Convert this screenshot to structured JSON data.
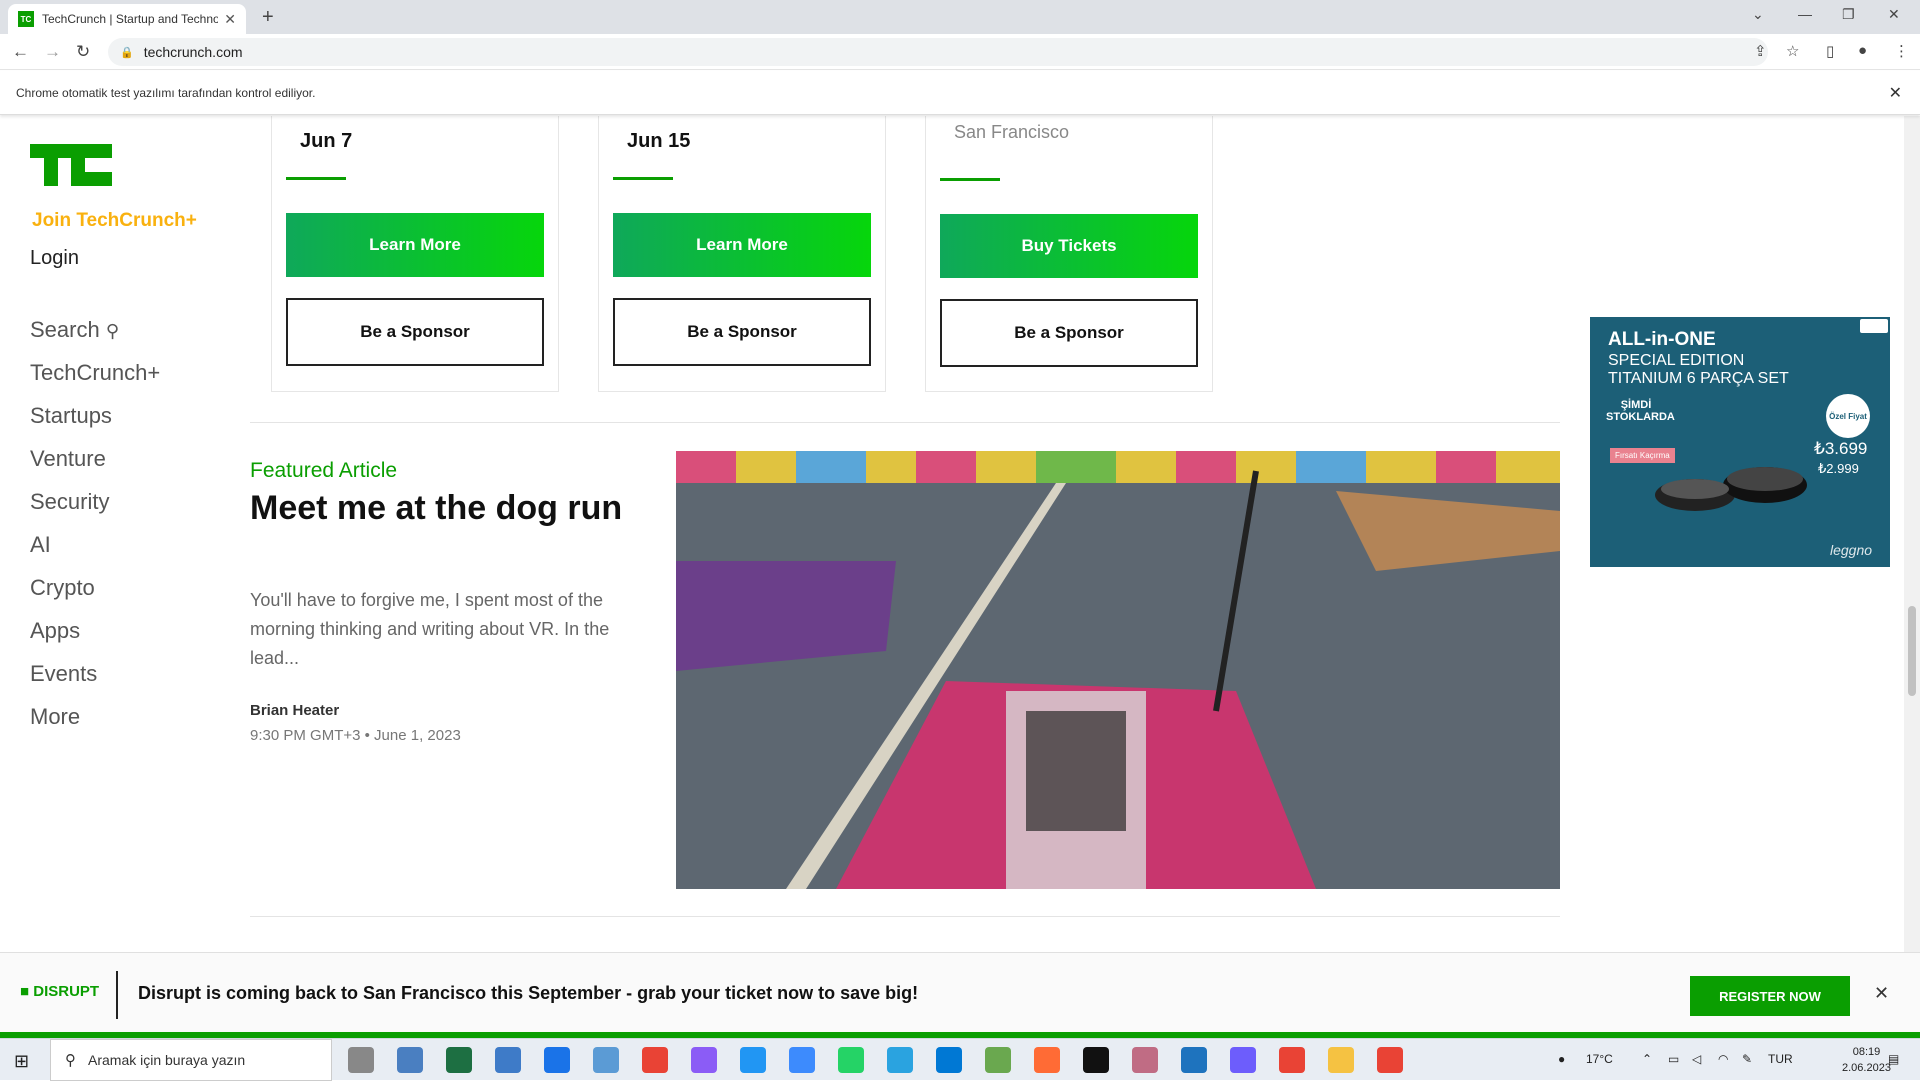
{
  "browser": {
    "tab_title": "TechCrunch | Startup and Technology News",
    "url": "techcrunch.com",
    "automation_notice": "Chrome otomatik test yazılımı tarafından kontrol ediliyor."
  },
  "sidebar": {
    "join": "Join TechCrunch+",
    "login": "Login",
    "items": [
      {
        "label": "Search"
      },
      {
        "label": "TechCrunch+"
      },
      {
        "label": "Startups"
      },
      {
        "label": "Venture"
      },
      {
        "label": "Security"
      },
      {
        "label": "AI"
      },
      {
        "label": "Crypto"
      },
      {
        "label": "Apps"
      },
      {
        "label": "Events"
      },
      {
        "label": "More"
      }
    ]
  },
  "events": [
    {
      "date": "Jun 7",
      "primary": "Learn More",
      "secondary": "Be a Sponsor"
    },
    {
      "date": "Jun 15",
      "primary": "Learn More",
      "secondary": "Be a Sponsor"
    },
    {
      "location": "San Francisco",
      "primary": "Buy Tickets",
      "secondary": "Be a Sponsor"
    }
  ],
  "featured": {
    "label": "Featured Article",
    "title": "Meet me at the dog run",
    "excerpt": "You'll have to forgive me, I spent most of the morning thinking and writing about VR. In the lead...",
    "author": "Brian Heater",
    "date": "9:30 PM GMT+3 • June 1, 2023"
  },
  "ad": {
    "line1": "ALL-in-ONE",
    "line2": "SPECIAL EDITION",
    "line3": "TITANIUM 6 PARÇA SET",
    "stock": "ŞİMDİ STOKLARDA",
    "badge": "Özel Fiyat",
    "discount": "Fırsatı Kaçırma",
    "price": "₺3.699",
    "price_old": "₺2.999",
    "brand": "leggno"
  },
  "banner": {
    "logo": "DISRUPT",
    "message": "Disrupt is coming back to San Francisco this September - grab your ticket now to save big!",
    "cta": "REGISTER NOW"
  },
  "taskbar": {
    "search_placeholder": "Aramak için buraya yazın",
    "weather": "17°C",
    "lang": "TUR",
    "time": "08:19",
    "date": "2.06.2023"
  },
  "colors": {
    "brand_green": "#0a9e01",
    "join_yellow": "#f9b10f"
  }
}
